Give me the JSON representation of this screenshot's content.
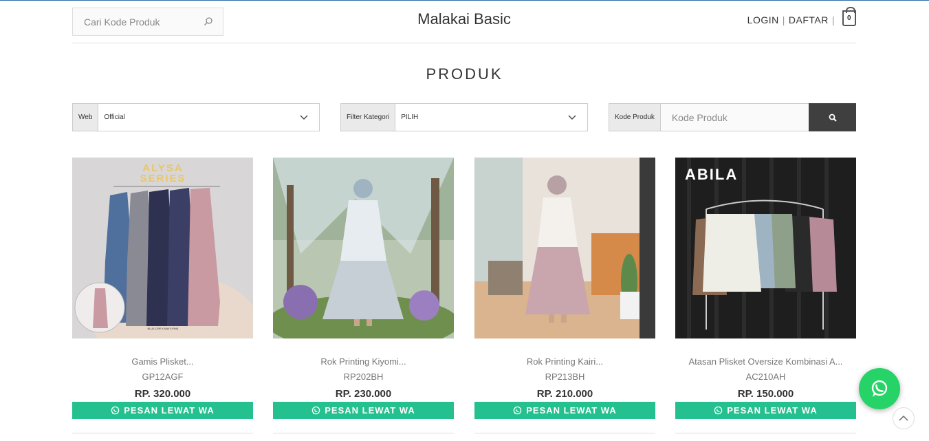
{
  "header": {
    "search_placeholder": "Cari Kode Produk",
    "brand": "Malakai Basic",
    "login": "LOGIN",
    "register": "DAFTAR",
    "separator": "|",
    "cart_count": "0"
  },
  "page_title": "PRODUK",
  "filters": {
    "web_label": "Web",
    "web_value": "Official",
    "category_label": "Filter Kategori",
    "category_value": "PILIH",
    "code_label": "Kode Produk",
    "code_placeholder": "Kode Produk"
  },
  "products": [
    {
      "name": "Gamis Plisket...",
      "code": "GP12AGF",
      "price": "RP. 320.000",
      "button": "PESAN LEWAT WA",
      "image_text": "ALYSA SERIES"
    },
    {
      "name": "Rok Printing Kiyomi...",
      "code": "RP202BH",
      "price": "RP. 230.000",
      "button": "PESAN LEWAT WA"
    },
    {
      "name": "Rok Printing Kairi...",
      "code": "RP213BH",
      "price": "RP. 210.000",
      "button": "PESAN LEWAT WA"
    },
    {
      "name": "Atasan Plisket Oversize Kombinasi A...",
      "code": "AC210AH",
      "price": "RP. 150.000",
      "button": "PESAN LEWAT WA",
      "image_text": "ABILA"
    }
  ],
  "colors": {
    "accent_green": "#25c08f",
    "whatsapp_green": "#25d366",
    "search_button": "#3f3f3f"
  },
  "icons": [
    "search-icon",
    "cart-icon",
    "chevron-down-icon",
    "whatsapp-icon",
    "arrow-up-icon"
  ]
}
